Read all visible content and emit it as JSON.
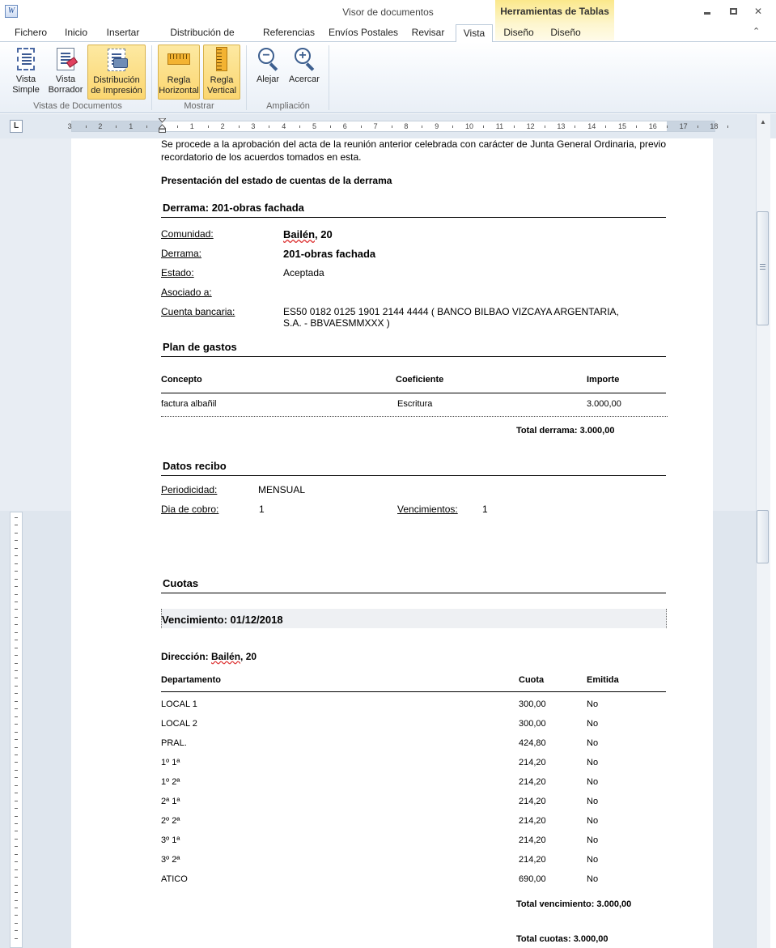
{
  "window": {
    "title": "Visor de documentos",
    "app_icon": "word-document-icon",
    "context_tools": "Herramientas de Tablas",
    "controls": [
      "minimize-icon",
      "restore-icon",
      "close-icon"
    ],
    "close_glyph": "✕"
  },
  "ribbon": {
    "tabs": [
      {
        "label": "Fichero"
      },
      {
        "label": "Inicio"
      },
      {
        "label": "Insertar"
      },
      {
        "label": "Distribución de Página"
      },
      {
        "label": "Referencias"
      },
      {
        "label": "Envíos Postales"
      },
      {
        "label": "Revisar"
      },
      {
        "label": "Vista",
        "active": true
      },
      {
        "label": "Diseño"
      },
      {
        "label": "Diseño"
      }
    ],
    "collapse_glyph": "⌃",
    "buttons": {
      "vista_simple": {
        "line1": "Vista",
        "line2": "Simple",
        "icon": "page-view-icon",
        "pressed": false
      },
      "vista_borrador": {
        "line1": "Vista",
        "line2": "Borrador",
        "icon": "draft-view-icon",
        "pressed": false
      },
      "distribucion": {
        "line1": "Distribución",
        "line2": "de Impresión",
        "icon": "print-layout-icon",
        "pressed": true
      },
      "regla_horizontal": {
        "line1": "Regla",
        "line2": "Horizontal",
        "icon": "horizontal-ruler-icon",
        "pressed": true
      },
      "regla_vertical": {
        "line1": "Regla",
        "line2": "Vertical",
        "icon": "vertical-ruler-icon",
        "pressed": true
      },
      "alejar": {
        "label": "Alejar",
        "icon": "zoom-out-icon",
        "glyph": "−"
      },
      "acercar": {
        "label": "Acercar",
        "icon": "zoom-in-icon",
        "glyph": "+"
      }
    },
    "groups": {
      "vistas": "Vistas de Documentos",
      "mostrar": "Mostrar",
      "ampliacion": "Ampliación"
    }
  },
  "ruler": {
    "tab_selector": "L",
    "left_numbers": [
      "3",
      "2",
      "1"
    ],
    "right_numbers": [
      "1",
      "2",
      "3",
      "4",
      "5",
      "6",
      "7",
      "8",
      "9",
      "10",
      "11",
      "12",
      "13",
      "14",
      "15",
      "16",
      "17",
      "18"
    ]
  },
  "scrollbar": {
    "up_glyph": "▲"
  },
  "document": {
    "intro": "Se procede a la aprobación del acta de la reunión anterior celebrada con carácter de Junta General Ordinaria, previo recordatorio de los acuerdos tomados en esta.",
    "presentation_title": "Presentación del estado de cuentas de la derrama",
    "derrama_title": "Derrama: 201-obras fachada",
    "fields": {
      "comunidad_label": "Comunidad:",
      "comunidad_value_a": "Bailén",
      "comunidad_value_b": ", 20",
      "derrama_label": "Derrama:",
      "derrama_value": "201-obras fachada",
      "estado_label": "Estado:",
      "estado_value": "Aceptada",
      "asociado_label": "Asociado a:",
      "cuenta_label": "Cuenta bancaria:",
      "cuenta_value_1": "ES50 0182 0125 1901 2144 4444 ( BANCO BILBAO VIZCAYA ARGENTARIA,",
      "cuenta_value_2": "S.A. - BBVAESMMXXX  )"
    },
    "plan": {
      "title": "Plan de gastos",
      "headers": {
        "concepto": "Concepto",
        "coeficiente": "Coeficiente",
        "importe": "Importe"
      },
      "row": {
        "concepto": "factura albañil",
        "coeficiente": "Escritura",
        "importe": "3.000,00"
      },
      "total": "Total derrama: 3.000,00"
    },
    "recibo": {
      "title": "Datos recibo",
      "periodicidad_label": "Periodicidad:",
      "periodicidad_value": "MENSUAL",
      "dia_label": "Dia de cobro:",
      "dia_value": "1",
      "venc_label": "Vencimientos:",
      "venc_value": "1"
    },
    "cuotas": {
      "title": "Cuotas",
      "vencimiento": "Vencimiento: 01/12/2018",
      "direccion_prefix": "Dirección: ",
      "direccion_a": "Bailén",
      "direccion_b": ", 20",
      "headers": {
        "departamento": "Departamento",
        "cuota": "Cuota",
        "emitida": "Emitida"
      },
      "rows": [
        {
          "dep": "LOCAL 1",
          "cuota": "300,00",
          "emitida": "No"
        },
        {
          "dep": "LOCAL 2",
          "cuota": "300,00",
          "emitida": "No"
        },
        {
          "dep": "PRAL.",
          "cuota": "424,80",
          "emitida": "No"
        },
        {
          "dep": "1º 1ª",
          "cuota": "214,20",
          "emitida": "No"
        },
        {
          "dep": "1º 2ª",
          "cuota": "214,20",
          "emitida": "No"
        },
        {
          "dep": "2ª 1ª",
          "cuota": "214,20",
          "emitida": "No"
        },
        {
          "dep": "2º 2ª",
          "cuota": "214,20",
          "emitida": "No"
        },
        {
          "dep": "3º 1ª",
          "cuota": "214,20",
          "emitida": "No"
        },
        {
          "dep": "3º 2ª",
          "cuota": "214,20",
          "emitida": "No"
        },
        {
          "dep": "ATICO",
          "cuota": "690,00",
          "emitida": "No"
        }
      ],
      "total_vencimiento": "Total vencimiento: 3.000,00",
      "total_cuotas": "Total cuotas: 3.000,00"
    }
  }
}
